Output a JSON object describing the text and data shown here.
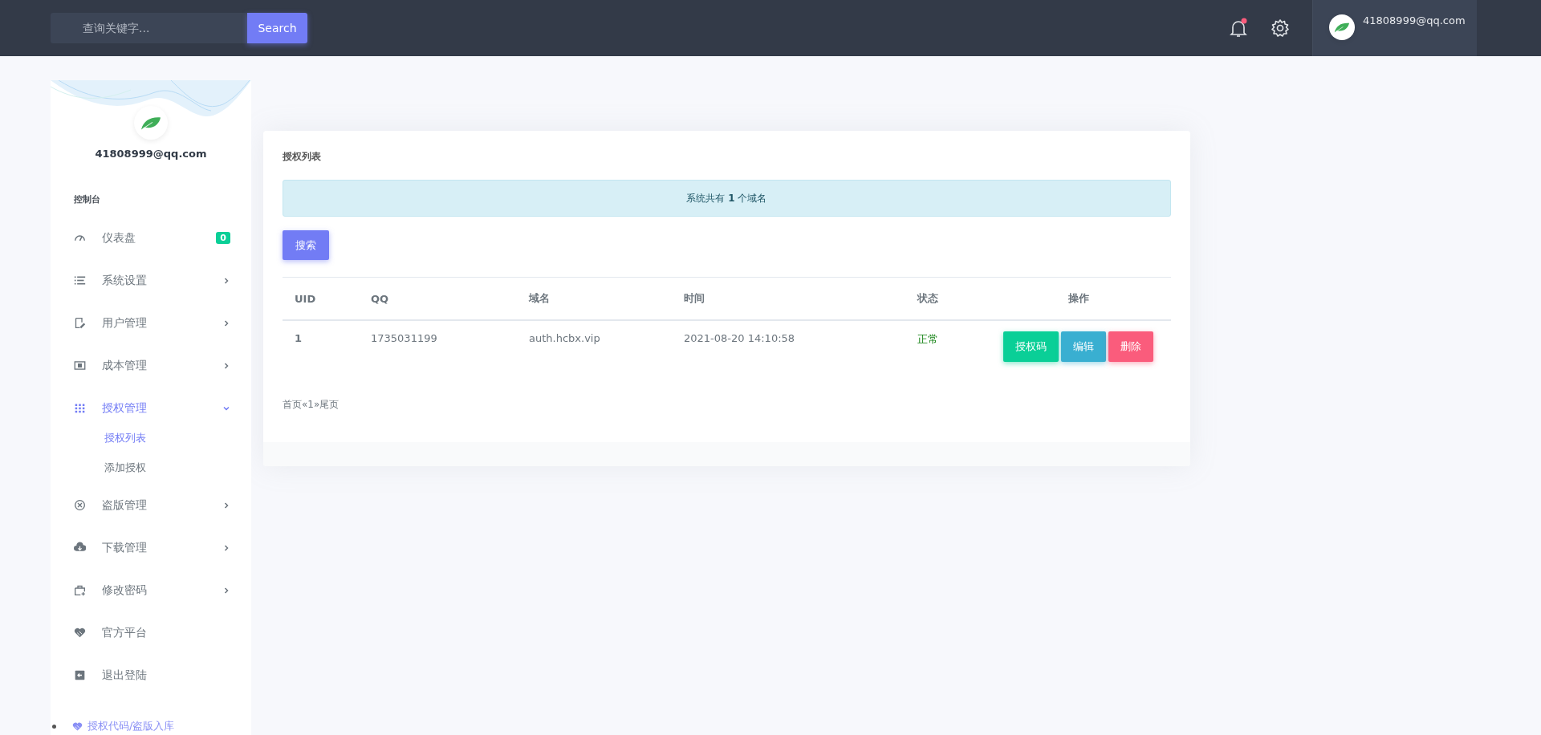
{
  "topbar": {
    "search": {
      "placeholder": "查询关键字...",
      "button": "Search"
    },
    "user": {
      "email": "41808999@qq.com"
    }
  },
  "sidebar": {
    "profile": {
      "email": "41808999@qq.com"
    },
    "section_title": "控制台",
    "items": [
      {
        "label": "仪表盘",
        "kind": "badge",
        "badge": "0",
        "active": false
      },
      {
        "label": "系统设置",
        "kind": "submenu",
        "expanded": false,
        "active": false
      },
      {
        "label": "用户管理",
        "kind": "submenu",
        "expanded": false,
        "active": false
      },
      {
        "label": "成本管理",
        "kind": "submenu",
        "expanded": false,
        "active": false
      },
      {
        "label": "授权管理",
        "kind": "submenu",
        "expanded": true,
        "active": true,
        "children": [
          {
            "label": "授权列表",
            "selected": true
          },
          {
            "label": "添加授权",
            "selected": false
          }
        ]
      },
      {
        "label": "盗版管理",
        "kind": "submenu",
        "expanded": false,
        "active": false
      },
      {
        "label": "下载管理",
        "kind": "submenu",
        "expanded": false,
        "active": false
      },
      {
        "label": "修改密码",
        "kind": "submenu",
        "expanded": false,
        "active": false
      },
      {
        "label": "官方平台",
        "kind": "link",
        "active": false
      },
      {
        "label": "退出登陆",
        "kind": "link",
        "active": false
      }
    ],
    "footer_link": "授权代码/盗版入库"
  },
  "card": {
    "title": "授权列表",
    "alert": "系统共有 **1** 个域名",
    "search_button": "搜索",
    "table": {
      "columns": [
        "UID",
        "QQ",
        "域名",
        "时间",
        "状态",
        "操作"
      ],
      "rows": [
        {
          "uid": "1",
          "qq": "1735031199",
          "domain": "auth.hcbx.vip",
          "time": "2021-08-20 14:10:58",
          "status": "正常",
          "actions": [
            {
              "label": "授权码",
              "kind": "success"
            },
            {
              "label": "编辑",
              "kind": "info"
            },
            {
              "label": "删除",
              "kind": "danger"
            }
          ]
        }
      ]
    },
    "pagination": "首页«1»尾页"
  }
}
